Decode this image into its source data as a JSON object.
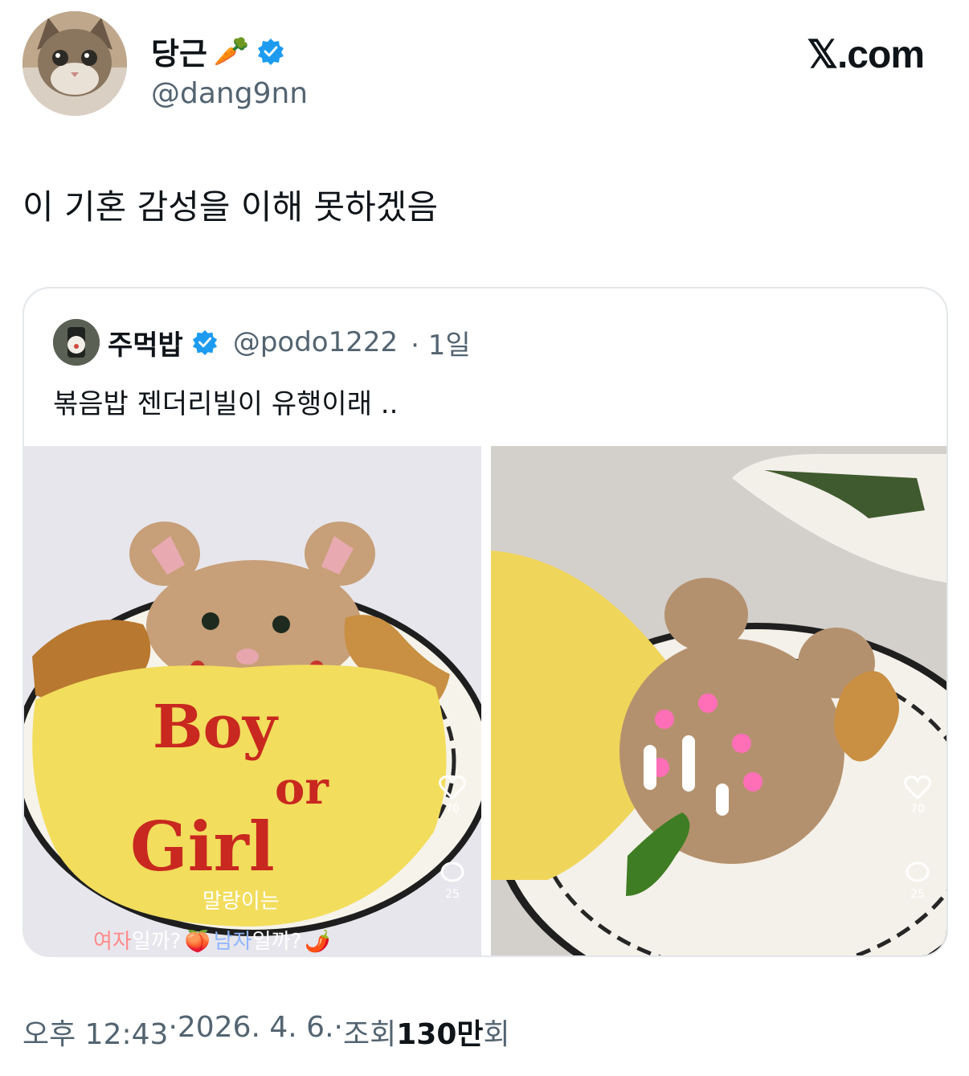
{
  "author": {
    "display_name": "당근",
    "name_emoji": "🥕",
    "handle": "@dang9nn",
    "verified_icon": "verified-badge-icon",
    "avatar_icon": "cat-avatar"
  },
  "site_logo": "𝕏.com",
  "tweet": {
    "text": "이 기혼 감성을 이해 못하겠음"
  },
  "quoted": {
    "display_name": "주먹밥",
    "handle": "@podo1222",
    "time": "· 1일",
    "text": "볶음밥 젠더리빌이 유행이래 ..",
    "photos": [
      {
        "description": "rice bear under omelet blanket",
        "ketchup_text_1": "Boy",
        "ketchup_text_2": "or",
        "ketchup_text_3": "Girl",
        "caption_line1": "말랑이는",
        "caption_line2a": "여자",
        "caption_line2b": "일까?",
        "caption_line2c": "남자",
        "caption_line2d": "일까?",
        "like_count": "70",
        "comment_count": "25"
      },
      {
        "description": "rice bear photo with heart stickers",
        "like_count": "70",
        "comment_count": "25"
      }
    ]
  },
  "footer": {
    "time": "오후 12:43",
    "sep1": " · ",
    "date": "2026. 4. 6.",
    "sep2": " · ",
    "views_label": "조회 ",
    "views_number": "130만",
    "views_suffix": "회"
  },
  "colors": {
    "primary_text": "#0f1419",
    "secondary_text": "#536471",
    "verified_blue": "#1d9bf0",
    "card_border": "#e3e7ea"
  }
}
